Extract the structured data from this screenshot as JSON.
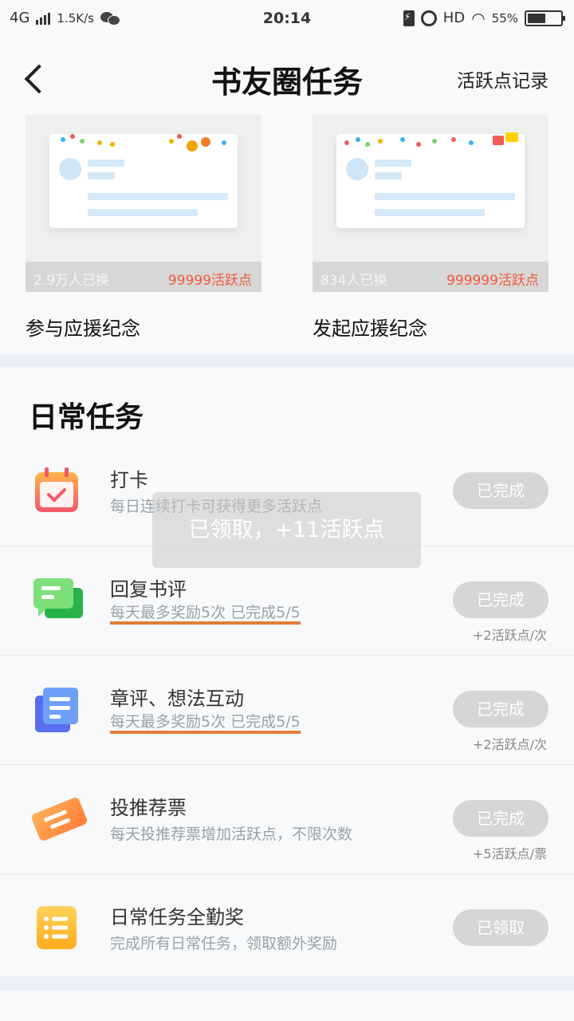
{
  "status_bar": {
    "network": "4G",
    "speed": "1.5K/s",
    "time": "20:14",
    "hd": "HD",
    "battery_text": "55%",
    "battery_level": 0.55
  },
  "header": {
    "title": "书友圈任务",
    "right_link": "活跃点记录"
  },
  "rewards": [
    {
      "count": "2.9万人已换",
      "price": "99999活跃点",
      "name": "参与应援纪念"
    },
    {
      "count": "834人已换",
      "price": "999999活跃点",
      "name": "发起应援纪念"
    }
  ],
  "daily": {
    "title": "日常任务",
    "tasks": [
      {
        "name": "打卡",
        "desc": "每日连续打卡可获得更多活跃点",
        "button": "已完成",
        "reward": "",
        "icon": "calendar-icon",
        "color": "#f36b6b"
      },
      {
        "name": "回复书评",
        "desc": "每天最多奖励5次  已完成5/5",
        "button": "已完成",
        "reward": "+2活跃点/次",
        "icon": "chat-icon",
        "color": "#4fcf5c"
      },
      {
        "name": "章评、想法互动",
        "desc": "每天最多奖励5次  已完成5/5",
        "button": "已完成",
        "reward": "+2活跃点/次",
        "icon": "document-icon",
        "color": "#5f7ff0"
      },
      {
        "name": "投推荐票",
        "desc": "每天投推荐票增加活跃点，不限次数",
        "button": "已完成",
        "reward": "+5活跃点/票",
        "icon": "ticket-icon",
        "color": "#ff9a4a"
      },
      {
        "name": "日常任务全勤奖",
        "desc": "完成所有日常任务，领取额外奖励",
        "button": "已领取",
        "reward": "",
        "icon": "list-icon",
        "color": "#ffc533"
      }
    ]
  },
  "toast": "已领取，+11活跃点"
}
